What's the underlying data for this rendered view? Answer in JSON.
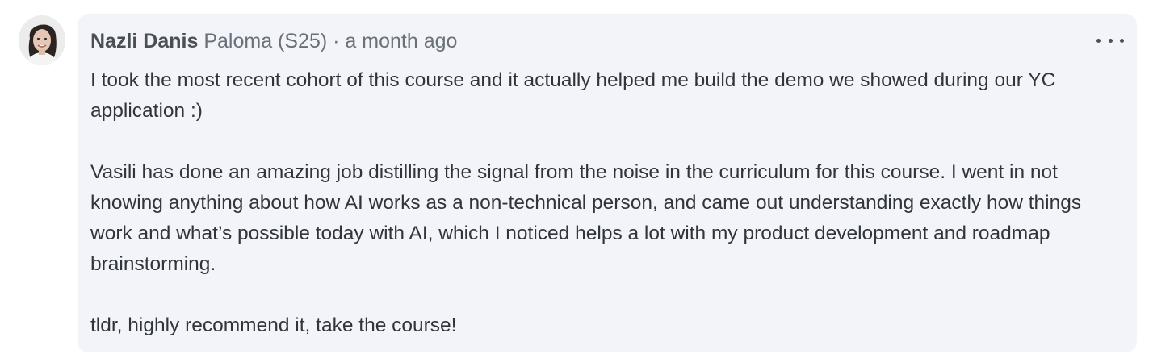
{
  "comment": {
    "author": "Nazli Danis",
    "affiliation": "Paloma (S25)",
    "separator": "·",
    "timestamp": "a month ago",
    "more_icon": "ellipsis-horizontal-icon",
    "paragraphs": [
      "I took the most recent cohort of this course and it actually helped me build the demo we showed during our YC application :)",
      "Vasili has done an amazing job distilling the signal from the noise in the curriculum for this course. I went in not knowing anything about how AI works as a non-technical person, and came out understanding exactly how things work and what’s possible today with AI, which I noticed helps a lot with my product development and roadmap brainstorming.",
      "tldr, highly recommend it, take the course!"
    ]
  },
  "colors": {
    "card_background": "#f2f4f9",
    "author_text": "#4a4f57",
    "meta_text": "#6a7079",
    "body_text": "#30353c"
  }
}
